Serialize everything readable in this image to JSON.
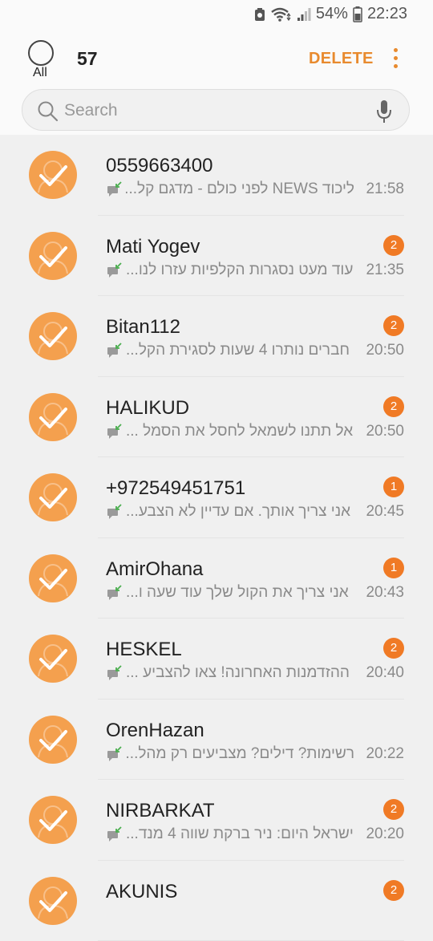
{
  "status_bar": {
    "battery": "54%",
    "time": "22:23"
  },
  "header": {
    "select_all_label": "All",
    "selected_count": "57",
    "delete_label": "DELETE"
  },
  "search": {
    "placeholder": "Search"
  },
  "conversations": [
    {
      "name": "0559663400",
      "preview": "ליכוד NEWS לפני כולם - מדגם קל...",
      "time": "21:58",
      "unread": ""
    },
    {
      "name": "Mati Yogev",
      "preview": "עוד מעט נסגרות הקלפיות עזרו לנו...",
      "time": "21:35",
      "unread": "2"
    },
    {
      "name": "Bitan112",
      "preview": "חברים נותרו 4 שעות לסגירת הקל...",
      "time": "20:50",
      "unread": "2"
    },
    {
      "name": "HALIKUD",
      "preview": "אל תתנו לשמאל לחסל את הסמל ...",
      "time": "20:50",
      "unread": "2"
    },
    {
      "name": "+972549451751",
      "preview": "אני צריך אותך. אם עדיין לא הצבע...",
      "time": "20:45",
      "unread": "1"
    },
    {
      "name": "AmirOhana",
      "preview": "אני צריך את הקול שלך עוד שעה ו...",
      "time": "20:43",
      "unread": "1"
    },
    {
      "name": "HESKEL",
      "preview": "ההזדמנות האחרונה! צאו להצביע ...",
      "time": "20:40",
      "unread": "2"
    },
    {
      "name": "OrenHazan",
      "preview": "רשימות? דילים? מצביעים רק מהל...",
      "time": "20:22",
      "unread": ""
    },
    {
      "name": "NIRBARKAT",
      "preview": "ישראל היום: ניר ברקת שווה 4 מנד...",
      "time": "20:20",
      "unread": "2"
    },
    {
      "name": "AKUNIS",
      "preview": "",
      "time": "",
      "unread": "2"
    }
  ]
}
